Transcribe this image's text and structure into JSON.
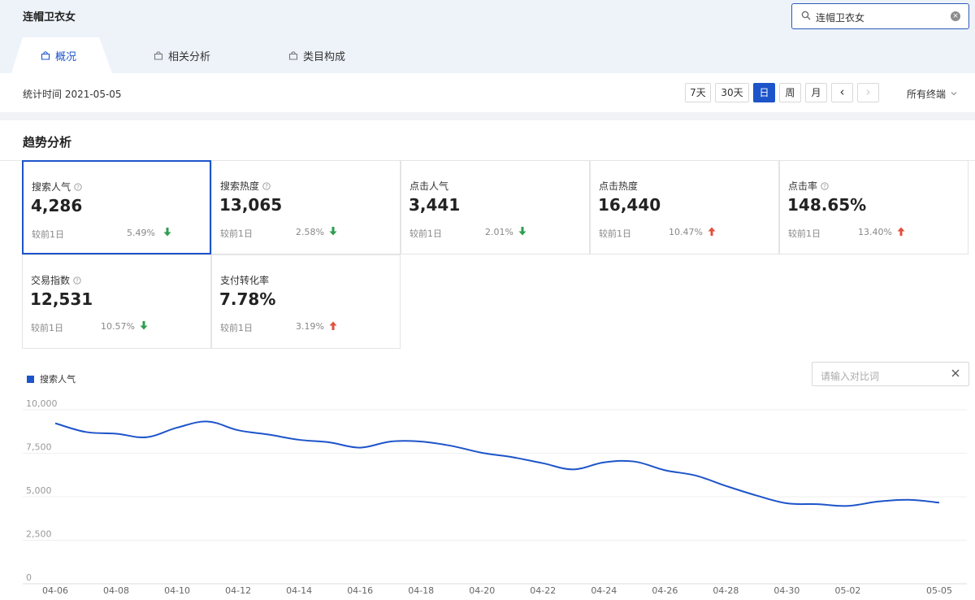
{
  "header": {
    "title": "连帽卫衣女",
    "search_value": "连帽卫衣女"
  },
  "tabs": [
    {
      "label": "概况",
      "active": true
    },
    {
      "label": "相关分析",
      "active": false
    },
    {
      "label": "类目构成",
      "active": false
    }
  ],
  "toolbar": {
    "stat_time": "统计时间 2021-05-05",
    "range_buttons": [
      "7天",
      "30天",
      "日",
      "周",
      "月"
    ],
    "active_range": "日",
    "prev_label": "‹",
    "next_label": "›",
    "device": "所有终端"
  },
  "section": {
    "title": "趋势分析"
  },
  "metrics": [
    {
      "label": "搜索人气",
      "help": true,
      "value": "4,286",
      "compare": "较前1日",
      "pct": "5.49%",
      "trend": "down",
      "selected": true
    },
    {
      "label": "搜索热度",
      "help": true,
      "value": "13,065",
      "compare": "较前1日",
      "pct": "2.58%",
      "trend": "down",
      "selected": false
    },
    {
      "label": "点击人气",
      "help": false,
      "value": "3,441",
      "compare": "较前1日",
      "pct": "2.01%",
      "trend": "down",
      "selected": false
    },
    {
      "label": "点击热度",
      "help": false,
      "value": "16,440",
      "compare": "较前1日",
      "pct": "10.47%",
      "trend": "up",
      "selected": false
    },
    {
      "label": "点击率",
      "help": true,
      "value": "148.65%",
      "compare": "较前1日",
      "pct": "13.40%",
      "trend": "up",
      "selected": false
    },
    {
      "label": "交易指数",
      "help": true,
      "value": "12,531",
      "compare": "较前1日",
      "pct": "10.57%",
      "trend": "down",
      "selected": false
    },
    {
      "label": "支付转化率",
      "help": false,
      "value": "7.78%",
      "compare": "较前1日",
      "pct": "3.19%",
      "trend": "up",
      "selected": false
    }
  ],
  "compare_input": {
    "placeholder": "请输入对比词"
  },
  "colors": {
    "accent": "#1d54c9",
    "down": "#2e9e4f",
    "up": "#e0503c"
  },
  "chart_data": {
    "type": "line",
    "series": [
      {
        "name": "搜索人气",
        "x": [
          "04-06",
          "04-07",
          "04-08",
          "04-09",
          "04-10",
          "04-11",
          "04-12",
          "04-13",
          "04-14",
          "04-15",
          "04-16",
          "04-17",
          "04-18",
          "04-19",
          "04-20",
          "04-21",
          "04-22",
          "04-23",
          "04-24",
          "04-25",
          "04-26",
          "04-27",
          "04-28",
          "04-29",
          "04-30",
          "05-01",
          "05-02",
          "05-03",
          "05-04",
          "05-05"
        ],
        "values": [
          8850,
          8350,
          8250,
          8050,
          8600,
          8950,
          8450,
          8200,
          7900,
          7750,
          7450,
          7800,
          7800,
          7550,
          7150,
          6900,
          6550,
          6200,
          6600,
          6650,
          6150,
          5850,
          5250,
          4700,
          4250,
          4200,
          4100,
          4350,
          4450,
          4286
        ]
      }
    ],
    "x_tick_labels": [
      "04-06",
      "04-08",
      "04-10",
      "04-12",
      "04-14",
      "04-16",
      "04-18",
      "04-20",
      "04-22",
      "04-24",
      "04-26",
      "04-28",
      "04-30",
      "05-02",
      "05-05"
    ],
    "y_tick_labels": [
      "10,000",
      "7,500",
      "5,000",
      "2,500",
      "0"
    ],
    "ylim": [
      0,
      10000
    ],
    "grid": true,
    "legend": "top-left"
  }
}
